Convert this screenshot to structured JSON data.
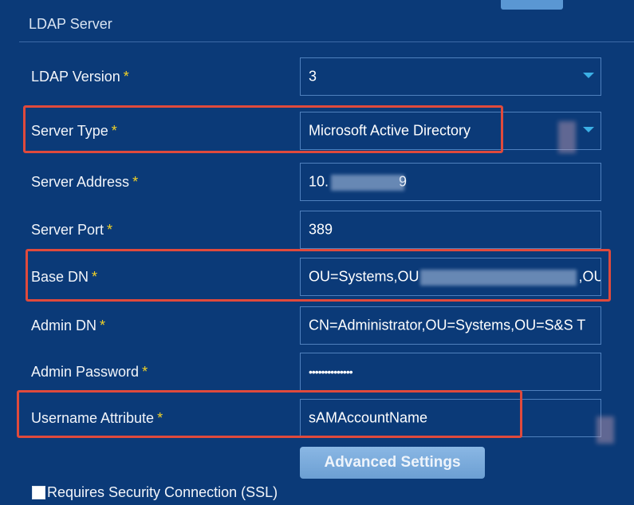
{
  "section": {
    "title": "LDAP Server"
  },
  "required_mark": "*",
  "fields": [
    {
      "label": "LDAP Version",
      "value": "3",
      "type": "select"
    },
    {
      "label": "Server Type",
      "value": "Microsoft Active Directory",
      "type": "select"
    },
    {
      "label": "Server Address",
      "value": "10.",
      "value_suffix": "9",
      "type": "text"
    },
    {
      "label": "Server Port",
      "value": "389",
      "type": "text"
    },
    {
      "label": "Base DN",
      "value": "OU=Systems,OU",
      "value_suffix": ",OU",
      "type": "text"
    },
    {
      "label": "Admin DN",
      "value": "CN=Administrator,OU=Systems,OU=S&S T",
      "type": "text"
    },
    {
      "label": "Admin Password",
      "value": "••••••••••••••",
      "type": "password"
    },
    {
      "label": "Username Attribute",
      "value": "sAMAccountName",
      "type": "text"
    }
  ],
  "buttons": {
    "advanced_settings": "Advanced Settings"
  },
  "ssl": {
    "label": "Requires Security Connection (SSL)",
    "checked": false
  },
  "colors": {
    "background": "#0b3a78",
    "field_border": "#4f80bd",
    "highlight": "#e04a3c",
    "required": "#f2d227",
    "dropdown_caret": "#3cb0e6",
    "button": "#7eaee0"
  }
}
